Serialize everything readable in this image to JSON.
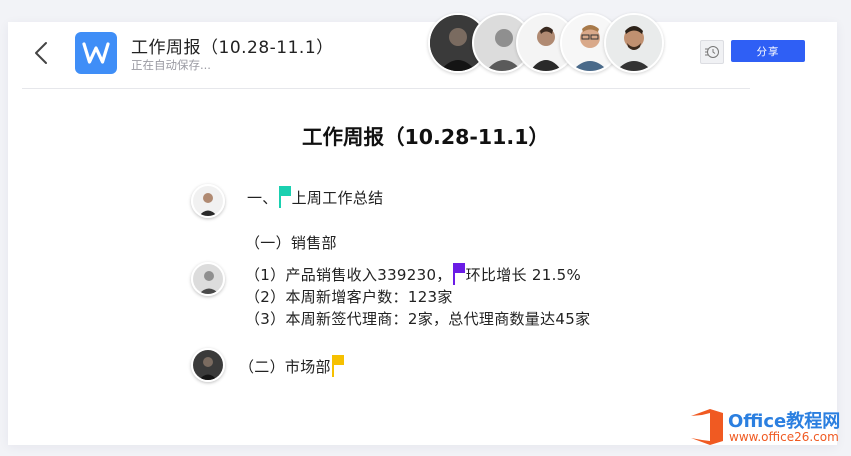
{
  "header": {
    "title": "工作周报（10.28-11.1）",
    "status": "正在自动保存...",
    "share_label": "分享"
  },
  "collaborators": [
    {
      "name": "collaborator-1"
    },
    {
      "name": "collaborator-2"
    },
    {
      "name": "collaborator-3"
    },
    {
      "name": "collaborator-4"
    },
    {
      "name": "collaborator-5"
    }
  ],
  "document": {
    "heading": "工作周报（10.28-11.1）",
    "section1": {
      "prefix": "一、",
      "text": "上周工作总结"
    },
    "sub1": "（一）销售部",
    "item1": {
      "prefix": "（1）产品销售收入339230，",
      "text": "环比增长 21.5%"
    },
    "item2": "（2）本周新增客户数：123家",
    "item3": "（3）本周新签代理商：2家，总代理商数量达45家",
    "sub2": "（二）市场部"
  },
  "colors": {
    "share": "#2f5ff5",
    "app_icon": "#3f8ef7",
    "flag_teal": "#1ad0b0",
    "flag_purple": "#6b1ce6",
    "flag_yellow": "#f6c000",
    "watermark_orange": "#f05a22",
    "watermark_blue": "#2b7fe0"
  },
  "watermark": {
    "brand": "Office教程网",
    "url": "www.office26.com"
  }
}
